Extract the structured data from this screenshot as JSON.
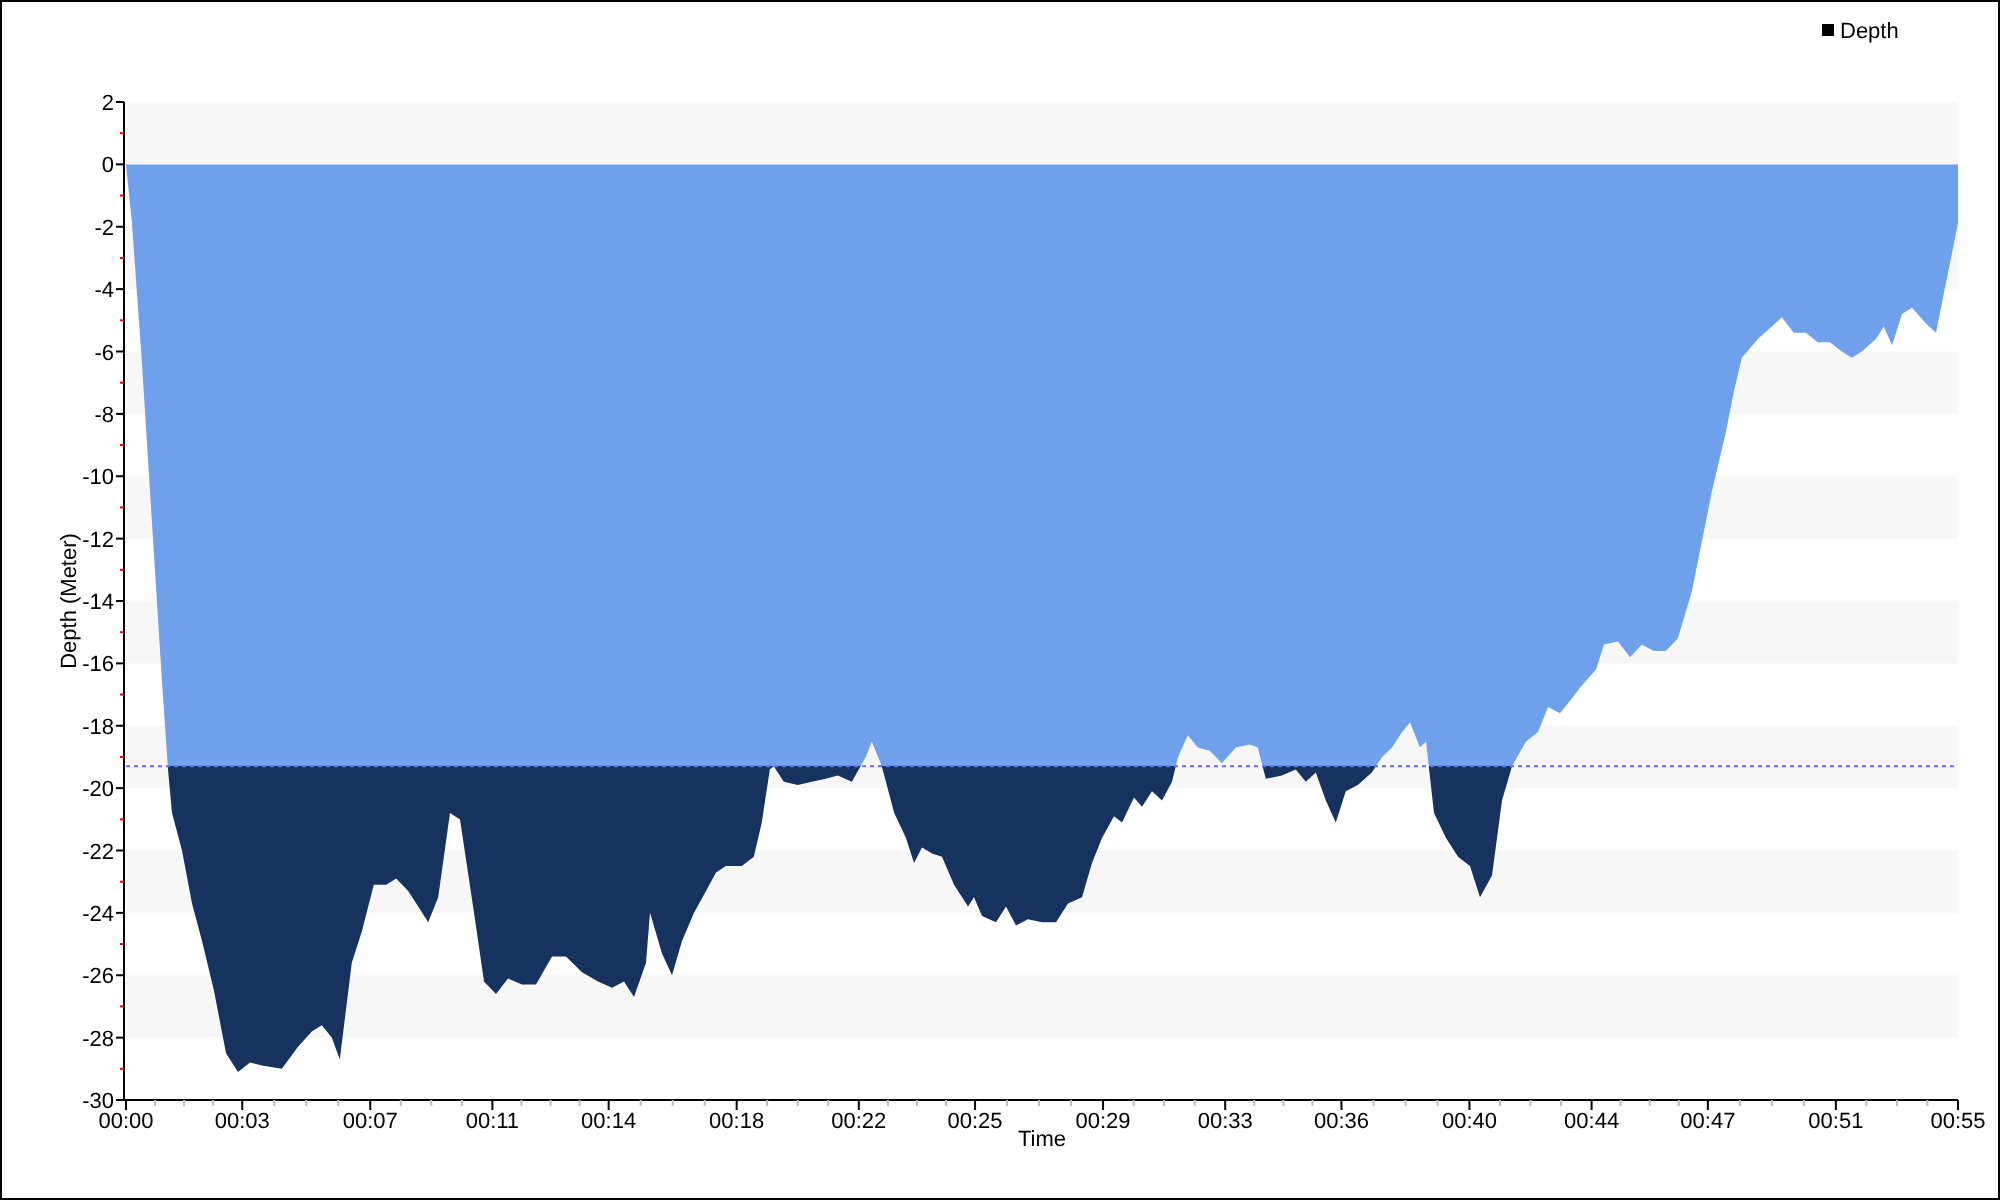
{
  "chart": {
    "chart_data": {
      "type": "area",
      "xlabel": "Time",
      "ylabel": "Depth (Meter)",
      "xlim": [
        0,
        55
      ],
      "ylim": [
        -30,
        2
      ],
      "xticks": [
        {
          "value": 0,
          "label": "00:00"
        },
        {
          "value": 3.49,
          "label": "00:03"
        },
        {
          "value": 7.333,
          "label": "00:07"
        },
        {
          "value": 11,
          "label": "00:11"
        },
        {
          "value": 14.49,
          "label": "00:14"
        },
        {
          "value": 18.333,
          "label": "00:18"
        },
        {
          "value": 22,
          "label": "00:22"
        },
        {
          "value": 25.49,
          "label": "00:25"
        },
        {
          "value": 29.333,
          "label": "00:29"
        },
        {
          "value": 33,
          "label": "00:33"
        },
        {
          "value": 36.49,
          "label": "00:36"
        },
        {
          "value": 40.333,
          "label": "00:40"
        },
        {
          "value": 44,
          "label": "00:44"
        },
        {
          "value": 47.49,
          "label": "00:47"
        },
        {
          "value": 51.333,
          "label": "00:51"
        },
        {
          "value": 55,
          "label": "00:55"
        }
      ],
      "yticks": [
        2,
        0,
        -2,
        -4,
        -6,
        -8,
        -10,
        -12,
        -14,
        -16,
        -18,
        -20,
        -22,
        -24,
        -26,
        -28,
        -30
      ],
      "x": [
        0,
        0.18,
        0.48,
        0.78,
        1.08,
        1.26,
        1.38,
        1.68,
        1.98,
        2.28,
        2.64,
        3.0,
        3.36,
        3.72,
        4.08,
        4.68,
        5.16,
        5.58,
        5.88,
        6.18,
        6.42,
        6.78,
        7.08,
        7.44,
        7.81,
        8.11,
        8.47,
        8.77,
        9.07,
        9.37,
        9.73,
        10.03,
        10.45,
        10.75,
        11.11,
        11.47,
        11.89,
        12.31,
        12.79,
        13.21,
        13.69,
        14.17,
        14.59,
        14.95,
        15.25,
        15.61,
        15.73,
        16.09,
        16.39,
        16.69,
        17.05,
        17.41,
        17.71,
        18.01,
        18.49,
        18.85,
        19.09,
        19.33,
        19.45,
        19.75,
        20.17,
        20.59,
        21.01,
        21.37,
        21.79,
        22.21,
        22.39,
        22.69,
        23.06,
        23.42,
        23.66,
        23.9,
        24.2,
        24.5,
        24.86,
        25.28,
        25.46,
        25.7,
        26.12,
        26.42,
        26.72,
        27.08,
        27.5,
        27.92,
        28.28,
        28.7,
        29.0,
        29.3,
        29.66,
        29.9,
        30.26,
        30.5,
        30.8,
        31.1,
        31.4,
        31.58,
        31.88,
        32.18,
        32.54,
        32.9,
        33.32,
        33.74,
        33.98,
        34.22,
        34.7,
        35.12,
        35.42,
        35.72,
        36.02,
        36.32,
        36.62,
        36.98,
        37.4,
        37.71,
        38.01,
        38.31,
        38.55,
        38.85,
        39.03,
        39.27,
        39.63,
        39.99,
        40.35,
        40.65,
        41.01,
        41.31,
        41.61,
        42.03,
        42.39,
        42.69,
        43.05,
        43.35,
        43.71,
        44.13,
        44.37,
        44.79,
        45.15,
        45.51,
        45.87,
        46.23,
        46.59,
        47.01,
        47.31,
        47.61,
        48.03,
        48.27,
        48.51,
        48.99,
        49.41,
        49.71,
        50.07,
        50.43,
        50.79,
        51.15,
        51.51,
        51.81,
        52.11,
        52.53,
        52.77,
        53.02,
        53.32,
        53.62,
        54.04,
        54.34,
        54.64,
        55.0
      ],
      "series": [
        {
          "name": "Depth",
          "color": "#6fa0eb",
          "values": [
            0,
            -1.9,
            -6.4,
            -11.5,
            -16.6,
            -19.4,
            -20.8,
            -22.0,
            -23.7,
            -24.9,
            -26.5,
            -28.5,
            -29.1,
            -28.8,
            -28.9,
            -29.0,
            -28.3,
            -27.8,
            -27.6,
            -28.0,
            -28.7,
            -25.6,
            -24.6,
            -23.1,
            -23.1,
            -22.9,
            -23.3,
            -23.8,
            -24.3,
            -23.5,
            -20.8,
            -21.0,
            -24.0,
            -26.2,
            -26.6,
            -26.1,
            -26.3,
            -26.3,
            -25.4,
            -25.4,
            -25.9,
            -26.2,
            -26.4,
            -26.2,
            -26.7,
            -25.6,
            -24.0,
            -25.3,
            -26.0,
            -24.9,
            -24.0,
            -23.3,
            -22.7,
            -22.5,
            -22.5,
            -22.2,
            -21.1,
            -19.4,
            -19.3,
            -19.8,
            -19.9,
            -19.8,
            -19.7,
            -19.6,
            -19.8,
            -19.0,
            -18.5,
            -19.3,
            -20.8,
            -21.6,
            -22.4,
            -21.9,
            -22.1,
            -22.2,
            -23.1,
            -23.8,
            -23.5,
            -24.1,
            -24.3,
            -23.8,
            -24.4,
            -24.2,
            -24.3,
            -24.3,
            -23.7,
            -23.5,
            -22.4,
            -21.6,
            -20.9,
            -21.1,
            -20.3,
            -20.6,
            -20.1,
            -20.4,
            -19.8,
            -19.0,
            -18.3,
            -18.7,
            -18.8,
            -19.2,
            -18.7,
            -18.6,
            -18.7,
            -19.7,
            -19.6,
            -19.4,
            -19.8,
            -19.5,
            -20.4,
            -21.1,
            -20.1,
            -19.9,
            -19.5,
            -19.0,
            -18.7,
            -18.2,
            -17.9,
            -18.7,
            -18.5,
            -20.8,
            -21.6,
            -22.2,
            -22.5,
            -23.5,
            -22.8,
            -20.4,
            -19.3,
            -18.5,
            -18.2,
            -17.4,
            -17.6,
            -17.2,
            -16.7,
            -16.2,
            -15.4,
            -15.3,
            -15.8,
            -15.4,
            -15.6,
            -15.6,
            -15.2,
            -13.7,
            -12.1,
            -10.5,
            -8.6,
            -7.3,
            -6.2,
            -5.6,
            -5.2,
            -4.9,
            -5.4,
            -5.4,
            -5.7,
            -5.7,
            -6.0,
            -6.2,
            -6.0,
            -5.6,
            -5.2,
            -5.8,
            -4.8,
            -4.6,
            -5.1,
            -5.4,
            -3.8,
            -1.9
          ]
        }
      ],
      "ref_lines": [
        {
          "axis": "y",
          "value": -19.3,
          "color": "#6b6bf0"
        }
      ]
    }
  }
}
